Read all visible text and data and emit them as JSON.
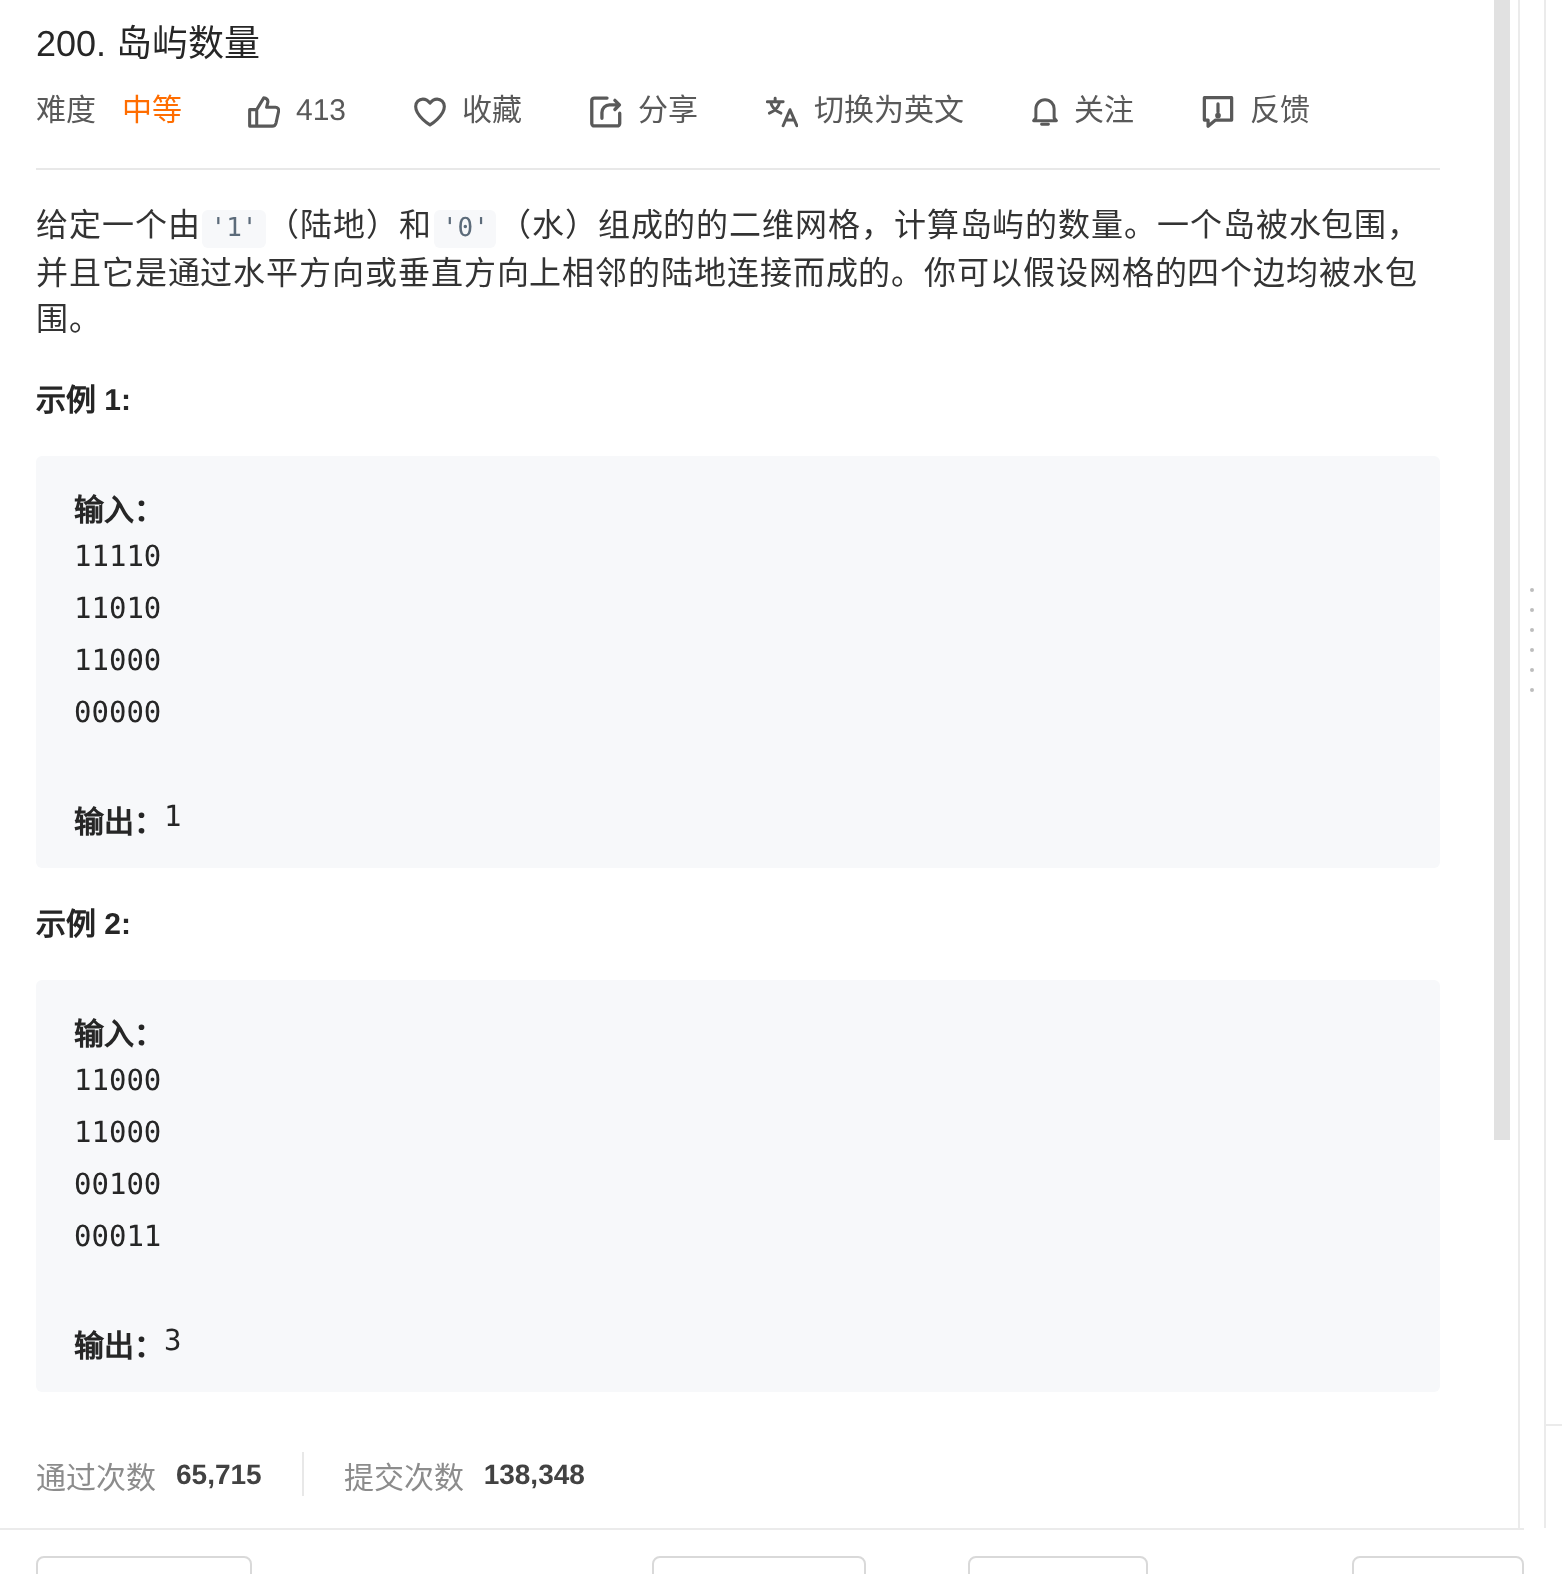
{
  "problem": {
    "title": "200. 岛屿数量"
  },
  "meta": {
    "difficulty": {
      "label": "难度",
      "value": "中等",
      "kind": "medium"
    },
    "actions": [
      {
        "kind": "like",
        "label": "413"
      },
      {
        "kind": "favorite",
        "label": "收藏"
      },
      {
        "kind": "share",
        "label": "分享"
      },
      {
        "kind": "translate",
        "label": "切换为英文"
      },
      {
        "kind": "follow",
        "label": "关注"
      },
      {
        "kind": "feedback",
        "label": "反馈"
      }
    ]
  },
  "description": [
    {
      "kind": "text",
      "text": "给定一个由"
    },
    {
      "kind": "code",
      "text": "'1'"
    },
    {
      "kind": "text",
      "text": "（陆地）和"
    },
    {
      "kind": "code",
      "text": "'0'"
    },
    {
      "kind": "text",
      "text": "（水）组成的的二维网格，计算岛屿的数量。一个岛被水包围，并且它是通过水平方向或垂直方向上相邻的陆地连接而成的。你可以假设网格的四个边均被水包围。"
    }
  ],
  "examples": [
    {
      "title": "示例 1:",
      "input_label": "输入：",
      "input_lines": [
        "11110",
        "11010",
        "11000",
        "00000"
      ],
      "output_label": "输出：",
      "output": "1"
    },
    {
      "title": "示例 2:",
      "input_label": "输入：",
      "input_lines": [
        "11000",
        "11000",
        "00100",
        "00011"
      ],
      "output_label": "输出：",
      "output": "3"
    }
  ],
  "stats": [
    {
      "label": "通过次数",
      "value": "65,715"
    },
    {
      "label": "提交次数",
      "value": "138,348"
    }
  ]
}
